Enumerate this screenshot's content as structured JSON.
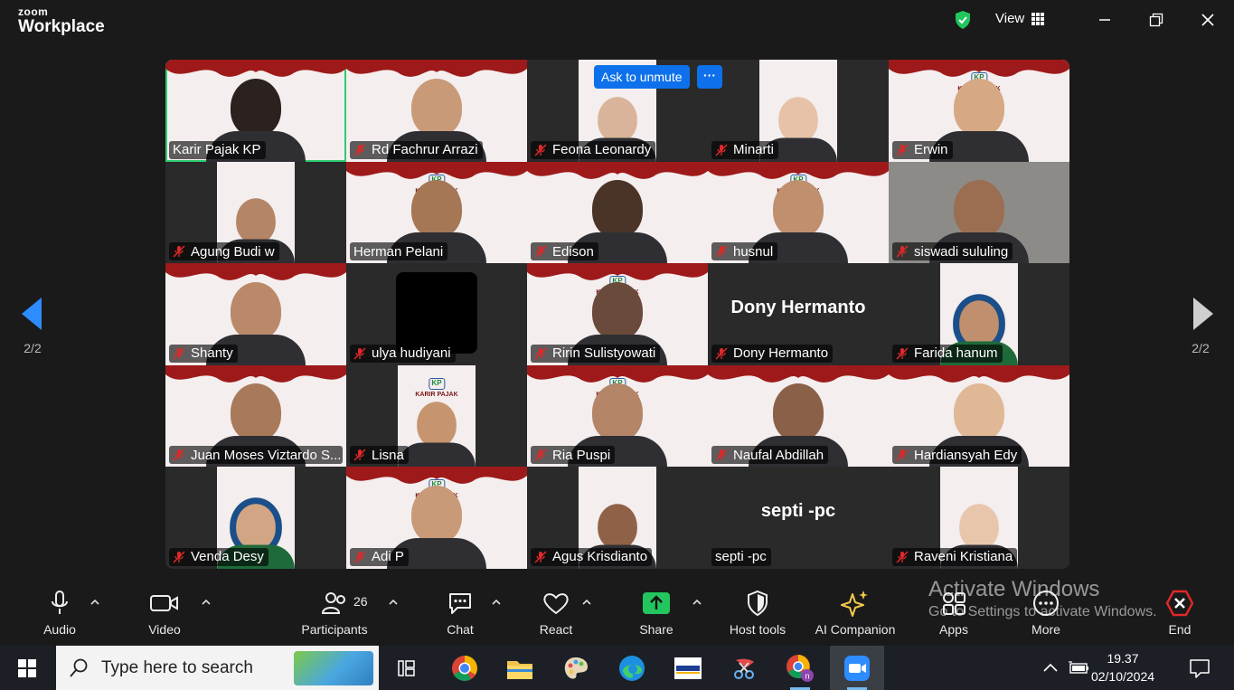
{
  "app": {
    "brand_top": "zoom",
    "brand_bottom": "Workplace",
    "view_label": "View"
  },
  "pagination": {
    "left": "2/2",
    "right": "2/2"
  },
  "tile_actions": {
    "ask_unmute": "Ask to unmute",
    "more": "···"
  },
  "participants": [
    {
      "name": "Karir Pajak KP",
      "muted": false,
      "active": true
    },
    {
      "name": "Rd Fachrur Arrazi",
      "muted": true
    },
    {
      "name": "Feona Leonardy",
      "muted": true
    },
    {
      "name": "Minarti",
      "muted": true
    },
    {
      "name": "Erwin",
      "muted": true
    },
    {
      "name": "Agung Budi w",
      "muted": true
    },
    {
      "name": "Herman Pelani",
      "muted": false
    },
    {
      "name": "Edison",
      "muted": true
    },
    {
      "name": "husnul",
      "muted": true
    },
    {
      "name": "siswadi sululing",
      "muted": true
    },
    {
      "name": "Shanty",
      "muted": true
    },
    {
      "name": "ulya hudiyani",
      "muted": true
    },
    {
      "name": "Ririn Sulistyowati",
      "muted": true
    },
    {
      "name": "Dony Hermanto",
      "muted": true,
      "center_text": "Dony Hermanto"
    },
    {
      "name": "Farida hanum",
      "muted": true
    },
    {
      "name": "Juan Moses Viztardo S...",
      "muted": true
    },
    {
      "name": "Lisna",
      "muted": true
    },
    {
      "name": "Ria Puspi",
      "muted": true
    },
    {
      "name": "Naufal Abdillah",
      "muted": true
    },
    {
      "name": "Hardiansyah Edy",
      "muted": true
    },
    {
      "name": "Venda Desy",
      "muted": true
    },
    {
      "name": "Adi P",
      "muted": true
    },
    {
      "name": "Agus Krisdianto",
      "muted": true
    },
    {
      "name": "septi -pc",
      "muted": false,
      "center_text": "septi -pc"
    },
    {
      "name": "Raveni Kristiana",
      "muted": true
    }
  ],
  "logo_text": {
    "badge": "KP",
    "caption": "KARIR PAJAK"
  },
  "toolbar": {
    "audio": "Audio",
    "video": "Video",
    "participants": "Participants",
    "participants_count": "26",
    "chat": "Chat",
    "react": "React",
    "share": "Share",
    "host_tools": "Host tools",
    "ai_companion": "AI Companion",
    "apps": "Apps",
    "more": "More",
    "end": "End"
  },
  "watermark": {
    "line1": "Activate Windows",
    "line2": "Go to Settings to activate Windows."
  },
  "taskbar": {
    "search_placeholder": "Type here to search",
    "time": "19.37",
    "date": "02/10/2024"
  },
  "colors": {
    "accent": "#0e71eb",
    "active_speaker": "#2ecc71",
    "end": "#e02828",
    "share": "#23c55e"
  }
}
